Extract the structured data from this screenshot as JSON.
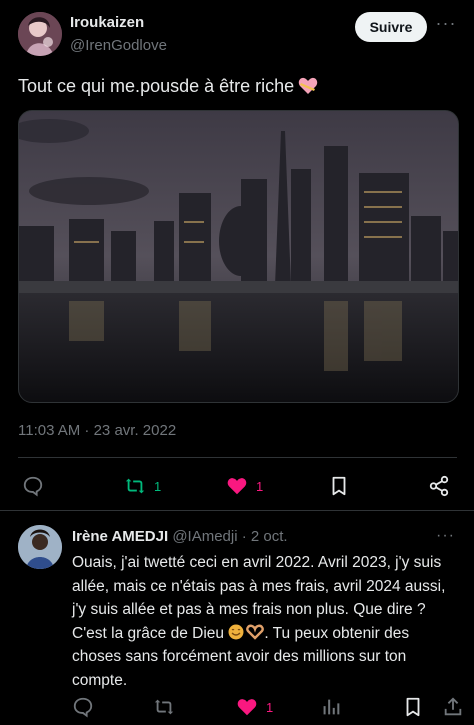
{
  "post": {
    "author_name": "Iroukaizen",
    "author_handle": "@IrenGodlove",
    "follow_label": "Suivre",
    "more_label": "···",
    "text": "Tout ce qui me.pousde à être riche",
    "timestamp": "11:03 AM · 23 avr. 2022",
    "actions": {
      "retweet_count": "1",
      "like_count": "1"
    }
  },
  "reply": {
    "author_name": "Irène AMEDJI",
    "author_handle": "@IAmedji",
    "dot": "·",
    "date": "2 oct.",
    "more_label": "···",
    "text_part1": "Ouais, j'ai twetté ceci en avril 2022. Avril 2023, j'y suis allée, mais ce n'étais pas à mes frais, avril 2024 aussi, j'y suis allée et pas à mes frais non plus. Que dire ? C'est la grâce de Dieu ",
    "text_part2": ". Tu peux obtenir des choses sans forcément avoir des millions sur ton compte.",
    "actions": {
      "like_count": "1"
    }
  },
  "colors": {
    "background": "#000000",
    "text": "#e7e9ea",
    "muted": "#71767b",
    "retweet_green": "#00ba7c",
    "like_pink": "#f91880"
  },
  "icons": [
    "reply-icon",
    "retweet-icon",
    "like-icon",
    "bookmark-icon",
    "share-icon",
    "views-icon",
    "more-icon"
  ]
}
